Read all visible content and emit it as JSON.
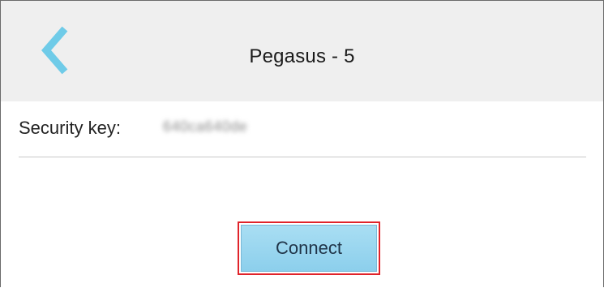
{
  "header": {
    "title": "Pegasus - 5",
    "back_icon": "chevron-left-icon",
    "accent_color": "#6fcbe8"
  },
  "security": {
    "label": "Security key:",
    "value": "640ca640de"
  },
  "actions": {
    "connect_label": "Connect",
    "highlight_color": "#e0232a"
  }
}
